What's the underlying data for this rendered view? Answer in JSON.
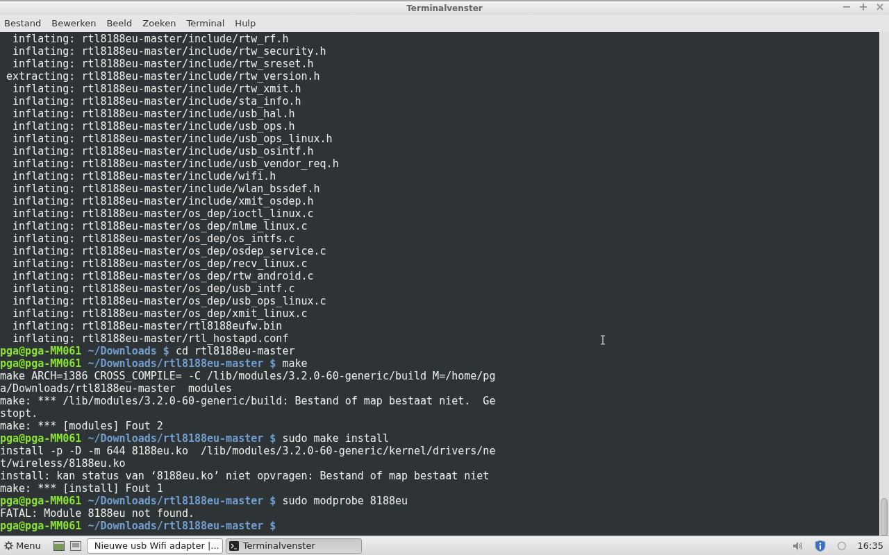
{
  "window": {
    "title": "Terminalvenster"
  },
  "menu": [
    "Bestand",
    "Bewerken",
    "Beeld",
    "Zoeken",
    "Terminal",
    "Hulp"
  ],
  "terminal": {
    "lines": [
      {
        "kind": "output",
        "text": "  inflating: rtl8188eu-master/include/rtw_rf.h"
      },
      {
        "kind": "output",
        "text": "  inflating: rtl8188eu-master/include/rtw_security.h"
      },
      {
        "kind": "output",
        "text": "  inflating: rtl8188eu-master/include/rtw_sreset.h"
      },
      {
        "kind": "output",
        "text": " extracting: rtl8188eu-master/include/rtw_version.h"
      },
      {
        "kind": "output",
        "text": "  inflating: rtl8188eu-master/include/rtw_xmit.h"
      },
      {
        "kind": "output",
        "text": "  inflating: rtl8188eu-master/include/sta_info.h"
      },
      {
        "kind": "output",
        "text": "  inflating: rtl8188eu-master/include/usb_hal.h"
      },
      {
        "kind": "output",
        "text": "  inflating: rtl8188eu-master/include/usb_ops.h"
      },
      {
        "kind": "output",
        "text": "  inflating: rtl8188eu-master/include/usb_ops_linux.h"
      },
      {
        "kind": "output",
        "text": "  inflating: rtl8188eu-master/include/usb_osintf.h"
      },
      {
        "kind": "output",
        "text": "  inflating: rtl8188eu-master/include/usb_vendor_req.h"
      },
      {
        "kind": "output",
        "text": "  inflating: rtl8188eu-master/include/wifi.h"
      },
      {
        "kind": "output",
        "text": "  inflating: rtl8188eu-master/include/wlan_bssdef.h"
      },
      {
        "kind": "output",
        "text": "  inflating: rtl8188eu-master/include/xmit_osdep.h"
      },
      {
        "kind": "output",
        "text": "  inflating: rtl8188eu-master/os_dep/ioctl_linux.c"
      },
      {
        "kind": "output",
        "text": "  inflating: rtl8188eu-master/os_dep/mlme_linux.c"
      },
      {
        "kind": "output",
        "text": "  inflating: rtl8188eu-master/os_dep/os_intfs.c"
      },
      {
        "kind": "output",
        "text": "  inflating: rtl8188eu-master/os_dep/osdep_service.c"
      },
      {
        "kind": "output",
        "text": "  inflating: rtl8188eu-master/os_dep/recv_linux.c"
      },
      {
        "kind": "output",
        "text": "  inflating: rtl8188eu-master/os_dep/rtw_android.c"
      },
      {
        "kind": "output",
        "text": "  inflating: rtl8188eu-master/os_dep/usb_intf.c"
      },
      {
        "kind": "output",
        "text": "  inflating: rtl8188eu-master/os_dep/usb_ops_linux.c"
      },
      {
        "kind": "output",
        "text": "  inflating: rtl8188eu-master/os_dep/xmit_linux.c"
      },
      {
        "kind": "output",
        "text": "  inflating: rtl8188eu-master/rtl8188eufw.bin"
      },
      {
        "kind": "output",
        "text": "  inflating: rtl8188eu-master/rtl_hostapd.conf"
      },
      {
        "kind": "prompt",
        "user": "pga@pga-MM061",
        "path": "~/Downloads $",
        "command": "cd rtl8188eu-master"
      },
      {
        "kind": "prompt",
        "user": "pga@pga-MM061",
        "path": "~/Downloads/rtl8188eu-master $",
        "command": "make"
      },
      {
        "kind": "output",
        "text": "make ARCH=i386 CROSS_COMPILE= -C /lib/modules/3.2.0-60-generic/build M=/home/pg"
      },
      {
        "kind": "output",
        "text": "a/Downloads/rtl8188eu-master  modules"
      },
      {
        "kind": "output",
        "text": "make: *** /lib/modules/3.2.0-60-generic/build: Bestand of map bestaat niet.  Ge"
      },
      {
        "kind": "output",
        "text": "stopt."
      },
      {
        "kind": "output",
        "text": "make: *** [modules] Fout 2"
      },
      {
        "kind": "prompt",
        "user": "pga@pga-MM061",
        "path": "~/Downloads/rtl8188eu-master $",
        "command": "sudo make install"
      },
      {
        "kind": "output",
        "text": "install -p -D -m 644 8188eu.ko  /lib/modules/3.2.0-60-generic/kernel/drivers/ne"
      },
      {
        "kind": "output",
        "text": "t/wireless/8188eu.ko"
      },
      {
        "kind": "output",
        "text": "install: kan status van ‘8188eu.ko’ niet opvragen: Bestand of map bestaat niet"
      },
      {
        "kind": "output",
        "text": "make: *** [install] Fout 1"
      },
      {
        "kind": "prompt",
        "user": "pga@pga-MM061",
        "path": "~/Downloads/rtl8188eu-master $",
        "command": "sudo modprobe 8188eu"
      },
      {
        "kind": "output",
        "text": "FATAL: Module 8188eu not found."
      },
      {
        "kind": "prompt",
        "user": "pga@pga-MM061",
        "path": "~/Downloads/rtl8188eu-master $"
      }
    ]
  },
  "taskbar": {
    "menu_label": "Menu",
    "tasks": [
      {
        "kind": "browser",
        "label": "Nieuwe usb Wifi adapter |...",
        "selected": false
      },
      {
        "kind": "terminal",
        "label": "Terminalvenster",
        "selected": true
      }
    ],
    "clock": "16:35"
  }
}
